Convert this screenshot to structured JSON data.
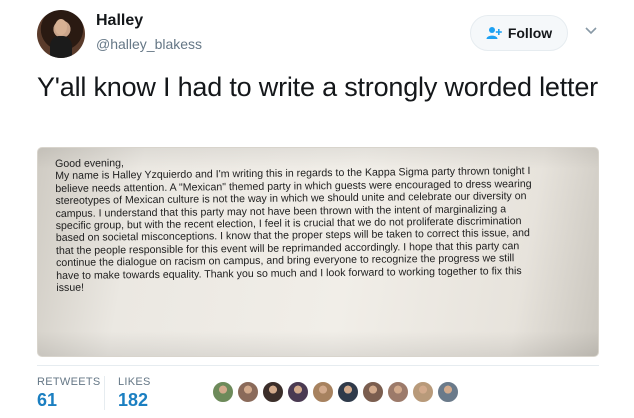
{
  "user": {
    "name": "Halley",
    "handle": "@halley_blakess"
  },
  "follow_button": {
    "label": "Follow",
    "icon": "follow-user-icon"
  },
  "more_menu": {
    "icon": "chevron-down-icon"
  },
  "tweet": {
    "text": "Y'all know I had to write a strongly worded letter"
  },
  "letter": {
    "lines": [
      "Good evening,",
      "My name is Halley Yzquierdo and I'm writing this in regards to the Kappa Sigma party thrown tonight I",
      "believe needs attention. A \"Mexican\" themed party in which guests were encouraged to dress wearing",
      "stereotypes of Mexican culture is not the way in which we should unite and celebrate our diversity on",
      "campus. I understand that this party may not have been thrown with the intent of marginalizing a",
      "specific group, but with the recent election, I feel it is crucial that we do not proliferate discrimination",
      "based on societal misconceptions. I know that the proper steps will be taken to correct this issue, and",
      "that the people responsible for this event will be reprimanded accordingly. I hope that this party can",
      "continue the dialogue on racism on campus, and bring everyone to recognize the progress we still",
      "have to make towards equality. Thank you so much and I look forward to working together to fix this",
      "issue!"
    ]
  },
  "stats": {
    "retweets_label": "RETWEETS",
    "retweets_count": "61",
    "likes_label": "LIKES",
    "likes_count": "182"
  },
  "likers": {
    "count_shown": 10,
    "colors": [
      "#6d8a5a",
      "#8a6a5a",
      "#3b2e2a",
      "#4a3a52",
      "#a7825f",
      "#2f3a4a",
      "#7b5e4f",
      "#9c7a6a",
      "#b89a7a",
      "#6a7a8a"
    ]
  },
  "colors": {
    "link_blue": "#1b7fc1",
    "secondary_text": "#657786",
    "primary_text": "#14171a"
  }
}
